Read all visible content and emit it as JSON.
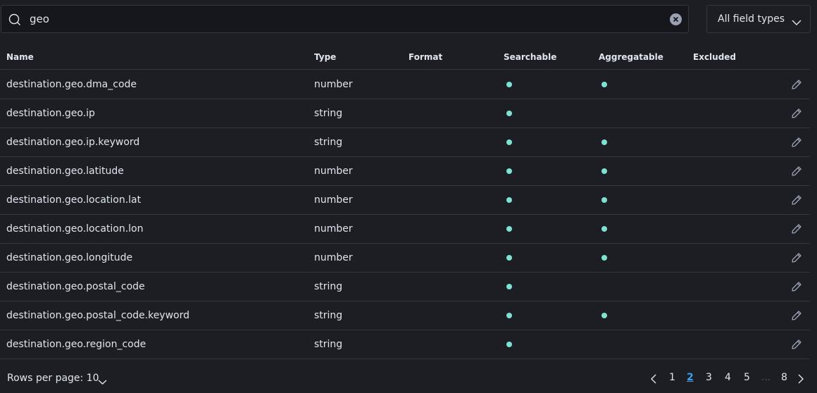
{
  "search": {
    "value": "geo"
  },
  "type_filter": {
    "label": "All field types"
  },
  "table": {
    "headers": [
      "Name",
      "Type",
      "Format",
      "Searchable",
      "Aggregatable",
      "Excluded"
    ],
    "rows": [
      {
        "name": "destination.geo.dma_code",
        "type": "number",
        "format": "",
        "searchable": true,
        "aggregatable": true,
        "excluded": false
      },
      {
        "name": "destination.geo.ip",
        "type": "string",
        "format": "",
        "searchable": true,
        "aggregatable": false,
        "excluded": false
      },
      {
        "name": "destination.geo.ip.keyword",
        "type": "string",
        "format": "",
        "searchable": true,
        "aggregatable": true,
        "excluded": false
      },
      {
        "name": "destination.geo.latitude",
        "type": "number",
        "format": "",
        "searchable": true,
        "aggregatable": true,
        "excluded": false
      },
      {
        "name": "destination.geo.location.lat",
        "type": "number",
        "format": "",
        "searchable": true,
        "aggregatable": true,
        "excluded": false
      },
      {
        "name": "destination.geo.location.lon",
        "type": "number",
        "format": "",
        "searchable": true,
        "aggregatable": true,
        "excluded": false
      },
      {
        "name": "destination.geo.longitude",
        "type": "number",
        "format": "",
        "searchable": true,
        "aggregatable": true,
        "excluded": false
      },
      {
        "name": "destination.geo.postal_code",
        "type": "string",
        "format": "",
        "searchable": true,
        "aggregatable": false,
        "excluded": false
      },
      {
        "name": "destination.geo.postal_code.keyword",
        "type": "string",
        "format": "",
        "searchable": true,
        "aggregatable": true,
        "excluded": false
      },
      {
        "name": "destination.geo.region_code",
        "type": "string",
        "format": "",
        "searchable": true,
        "aggregatable": false,
        "excluded": false
      }
    ]
  },
  "footer": {
    "rows_per_page": "Rows per page: 10",
    "pages": [
      "1",
      "2",
      "3",
      "4",
      "5"
    ],
    "ellipsis": "...",
    "last_page": "8",
    "active_page": "2"
  },
  "colors": {
    "accent": "#36a2ef",
    "indicator": "#7de2d1",
    "background": "#1d1e24"
  },
  "icons": {
    "search": "search-icon",
    "clear": "clear-icon",
    "chevron": "chevron-down-icon",
    "edit": "pencil-icon",
    "prev": "chevron-left-icon",
    "next": "chevron-right-icon"
  }
}
